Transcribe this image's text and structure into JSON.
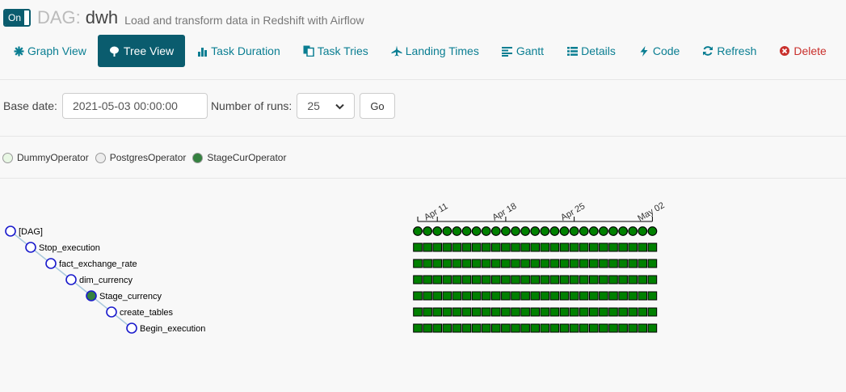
{
  "header": {
    "toggle_label": "On",
    "dag_label": "DAG:",
    "dag_id": "dwh",
    "description": "Load and transform data in Redshift with Airflow"
  },
  "nav": [
    {
      "label": "Graph View",
      "icon": "asterisk-icon"
    },
    {
      "label": "Tree View",
      "icon": "tree-icon",
      "active": true
    },
    {
      "label": "Task Duration",
      "icon": "bar-chart-icon"
    },
    {
      "label": "Task Tries",
      "icon": "duplicate-icon"
    },
    {
      "label": "Landing Times",
      "icon": "plane-icon"
    },
    {
      "label": "Gantt",
      "icon": "align-left-icon"
    },
    {
      "label": "Details",
      "icon": "list-icon"
    },
    {
      "label": "Code",
      "icon": "flash-icon"
    },
    {
      "label": "Refresh",
      "icon": "refresh-icon"
    },
    {
      "label": "Delete",
      "icon": "remove-circle-icon"
    }
  ],
  "form": {
    "base_date_label": "Base date:",
    "base_date_value": "2021-05-03 00:00:00",
    "num_runs_label": "Number of runs:",
    "num_runs_value": "25",
    "go_label": "Go"
  },
  "legend": [
    {
      "label": "DummyOperator",
      "color": "#e8f7e4"
    },
    {
      "label": "PostgresOperator",
      "color": "#ededed"
    },
    {
      "label": "StageCurOperator",
      "color": "#358140"
    }
  ],
  "tree": {
    "nodes": [
      "[DAG]",
      "Stop_execution",
      "fact_exchange_rate",
      "dim_currency",
      "Stage_currency",
      "create_tables",
      "Begin_execution"
    ],
    "stage_index": 4,
    "run_count": 25,
    "date_ticks": [
      "Apr 11",
      "Apr 18",
      "Apr 25",
      "May 02"
    ],
    "success_color": "#008000"
  }
}
